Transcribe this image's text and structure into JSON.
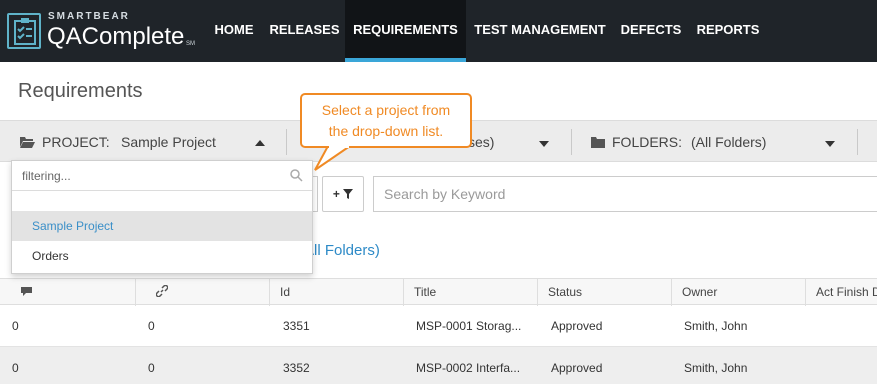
{
  "brand": {
    "small": "SMARTBEAR",
    "big": "QAComplete",
    "tm": "SM"
  },
  "nav": {
    "items": [
      {
        "label": "HOME"
      },
      {
        "label": "RELEASES"
      },
      {
        "label": "REQUIREMENTS"
      },
      {
        "label": "TEST MANAGEMENT"
      },
      {
        "label": "DEFECTS"
      },
      {
        "label": "REPORTS"
      }
    ],
    "active": "REQUIREMENTS"
  },
  "page_title": "Requirements",
  "filter_bar": {
    "project_label": "PROJECT:",
    "project_value": "Sample Project",
    "release_value_partial": "ses)",
    "folders_label": "FOLDERS:",
    "folders_value": "(All Folders)"
  },
  "search": {
    "placeholder": "Search by Keyword",
    "filter_button_label": "+"
  },
  "folders_link_partial": "All Folders)",
  "dropdown": {
    "filter_placeholder": "filtering...",
    "items": [
      {
        "label": "Sample Project",
        "selected": true
      },
      {
        "label": "Orders",
        "selected": false
      }
    ]
  },
  "callout": {
    "line1": "Select a project from",
    "line2": "the drop-down list."
  },
  "grid": {
    "columns": [
      "",
      "",
      "Id",
      "Title",
      "Status",
      "Owner",
      "Act Finish D"
    ],
    "rows": [
      {
        "comments": "0",
        "links": "0",
        "id": "3351",
        "title": "MSP-0001 Storag...",
        "status": "Approved",
        "owner": "Smith, John"
      },
      {
        "comments": "0",
        "links": "0",
        "id": "3352",
        "title": "MSP-0002 Interfa...",
        "status": "Approved",
        "owner": "Smith, John"
      }
    ]
  },
  "colors": {
    "nav_bg": "#1f2429",
    "accent": "#3aa6d8",
    "callout": "#f08a24",
    "link": "#2d8ac7"
  }
}
